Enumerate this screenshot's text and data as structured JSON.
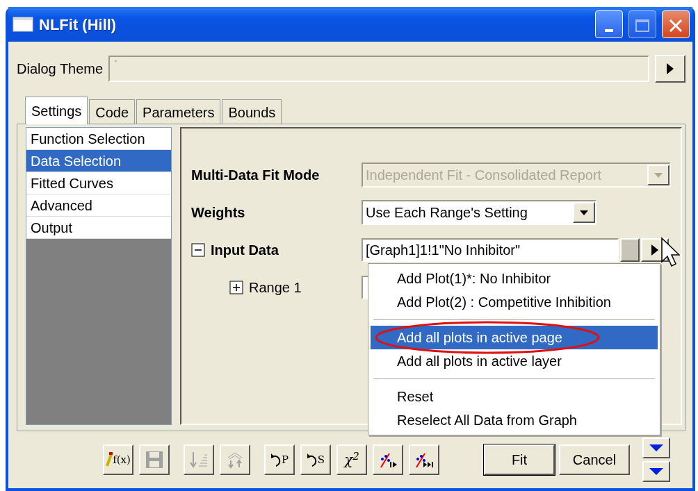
{
  "window": {
    "title": "NLFit (Hill)"
  },
  "theme": {
    "label": "Dialog Theme",
    "placeholder": "*"
  },
  "tabs": [
    {
      "label": "Settings",
      "selected": true
    },
    {
      "label": "Code",
      "selected": false
    },
    {
      "label": "Parameters",
      "selected": false
    },
    {
      "label": "Bounds",
      "selected": false
    }
  ],
  "sidebar": {
    "items": [
      {
        "label": "Function Selection",
        "selected": false
      },
      {
        "label": "Data Selection",
        "selected": true
      },
      {
        "label": "Fitted Curves",
        "selected": false
      },
      {
        "label": "Advanced",
        "selected": false
      },
      {
        "label": "Output",
        "selected": false
      }
    ]
  },
  "settings": [
    {
      "label": "Multi-Data Fit Mode",
      "kind": "combo",
      "value": "Independent Fit - Consolidated Report",
      "disabled": true
    },
    {
      "label": "Weights",
      "kind": "combo",
      "value": "Use Each Range's Setting",
      "disabled": false
    },
    {
      "label": "Input Data",
      "kind": "range",
      "value": "[Graph1]1!1\"No Inhibitor\"",
      "expanded": true,
      "children": [
        {
          "label": "Range 1",
          "kind": "range",
          "expanded": false
        }
      ]
    }
  ],
  "menu": [
    {
      "kind": "item",
      "label": "Add Plot(1)*: No Inhibitor",
      "selected": false,
      "circled": false
    },
    {
      "kind": "item",
      "label": "Add Plot(2) : Competitive Inhibition",
      "selected": false,
      "circled": false
    },
    {
      "kind": "separator"
    },
    {
      "kind": "item",
      "label": "Add all plots in active page",
      "selected": true,
      "circled": true
    },
    {
      "kind": "item",
      "label": "Add all plots in active layer",
      "selected": false,
      "circled": false
    },
    {
      "kind": "separator"
    },
    {
      "kind": "item",
      "label": "Reset",
      "selected": false,
      "circled": false
    },
    {
      "kind": "item",
      "label": "Reselect All Data from Graph",
      "selected": false,
      "circled": false
    }
  ],
  "toolbar": [
    {
      "kind": "function",
      "label": "f(x)",
      "disabled": false
    },
    {
      "kind": "save",
      "disabled": true
    },
    {
      "kind": "sort-down",
      "disabled": true
    },
    {
      "kind": "sort-updown",
      "disabled": true
    },
    {
      "kind": "reset",
      "label": "P",
      "disabled": false
    },
    {
      "kind": "reset",
      "label": "S",
      "disabled": false
    },
    {
      "kind": "chi",
      "label": "χ$^{2}$",
      "disabled": false
    },
    {
      "kind": "iterate",
      "disabled": false
    },
    {
      "kind": "fit-until",
      "disabled": false
    }
  ],
  "buttons": [
    {
      "label": "Fit",
      "default": true
    },
    {
      "label": "Cancel",
      "default": false
    }
  ]
}
